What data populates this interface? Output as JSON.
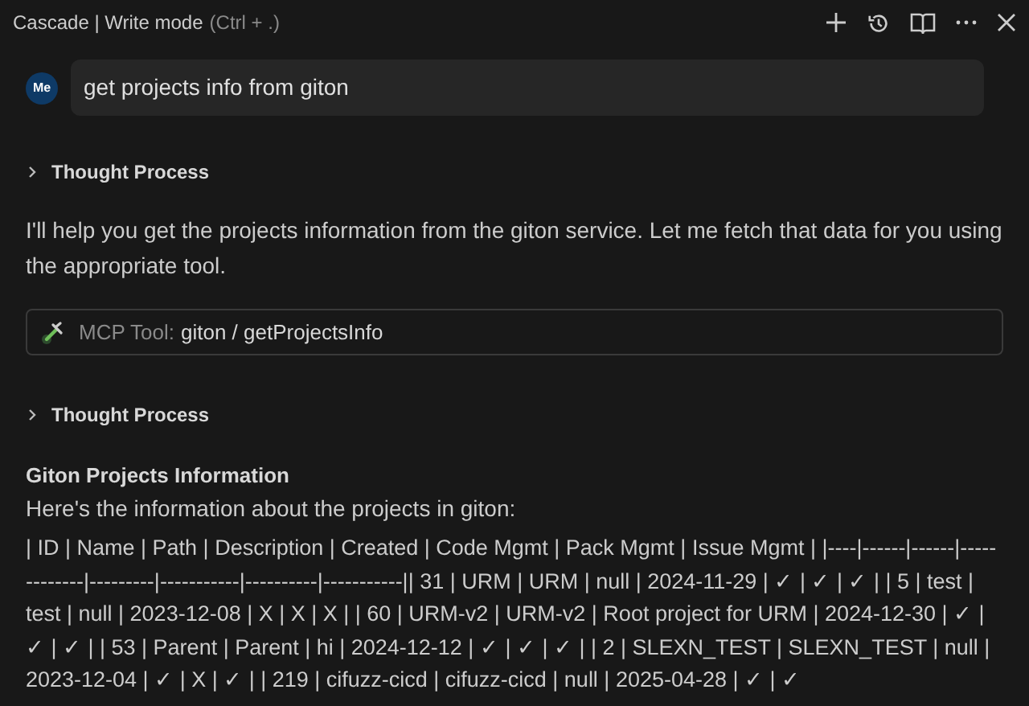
{
  "header": {
    "title": "Cascade | Write mode",
    "shortcut": "(Ctrl + .)"
  },
  "user_message": {
    "avatar": "Me",
    "text": "get projects info from giton"
  },
  "messages": [
    {
      "kind": "thought",
      "label": "Thought Process",
      "expanded": false
    },
    {
      "kind": "paragraph",
      "text": "I'll help you get the projects information from the giton service. Let me fetch that data for you using the appropriate tool."
    },
    {
      "kind": "tool",
      "label": "MCP Tool:",
      "text": "giton / getProjectsInfo"
    },
    {
      "kind": "thought",
      "label": "Thought Process",
      "expanded": false
    },
    {
      "kind": "heading",
      "text": "Giton Projects Information"
    },
    {
      "kind": "paragraph",
      "text": "Here's the information about the projects in giton:"
    },
    {
      "kind": "table_text",
      "text": "| ID | Name | Path | Description | Created | Code Mgmt | Pack Mgmt | Issue Mgmt | |----|------|------|-------------|---------|-----------|----------|-----------|| 31 | URM | URM | null | 2024-11-29 | ✓ | ✓ | ✓ | | 5 | test | test | null | 2023-12-08 | X | X | X | | 60 | URM-v2 | URM-v2 | Root project for URM | 2024-12-30 | ✓ | ✓ | ✓ | | 53 | Parent | Parent | hi | 2024-12-12 | ✓ | ✓ | ✓ | | 2 | SLEXN_TEST | SLEXN_TEST | null | 2023-12-04 | ✓ | X | ✓ | | 219 | cifuzz-cicd | cifuzz-cicd | null | 2025-04-28 | ✓ | ✓"
    }
  ]
}
